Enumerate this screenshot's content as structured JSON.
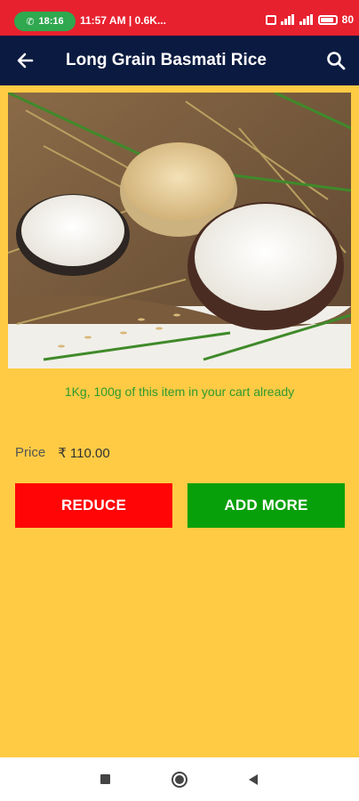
{
  "status_bar": {
    "call_time": "18:16",
    "info": "11:57 AM | 0.6K...",
    "battery": "80"
  },
  "app_bar": {
    "title": "Long Grain Basmati Rice"
  },
  "product": {
    "cart_note": "1Kg, 100g of this item in your cart already",
    "price_label": "Price",
    "price_value": "₹ 110.00"
  },
  "actions": {
    "reduce_label": "REDUCE",
    "add_label": "ADD MORE"
  },
  "colors": {
    "status_bar": "#e8212f",
    "app_bar": "#0b1a40",
    "background": "#ffcb44",
    "reduce": "#ff0505",
    "add": "#08a00a",
    "cart_note": "#2e9a2e"
  }
}
